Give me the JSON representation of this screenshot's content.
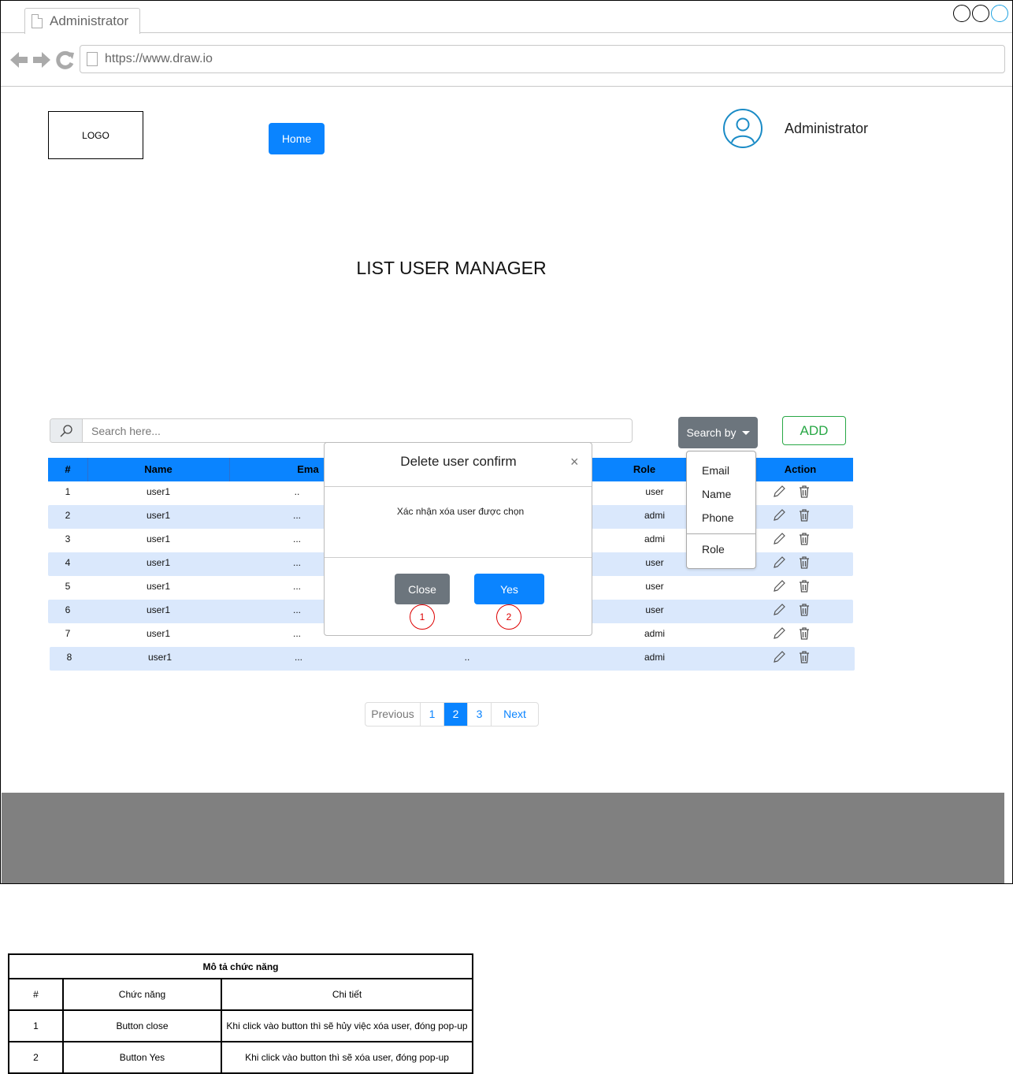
{
  "browser": {
    "tab_title": "Administrator",
    "url": "https://www.draw.io"
  },
  "header": {
    "logo": "LOGO",
    "home_button": "Home",
    "user_name": "Administrator"
  },
  "page_title": "LIST USER MANAGER",
  "toolbar": {
    "search_placeholder": "Search here...",
    "search_by_label": "Search by",
    "add_label": "ADD"
  },
  "search_by_menu": [
    "Email",
    "Name",
    "Phone",
    "Role"
  ],
  "table": {
    "columns": [
      "#",
      "Name",
      "Ema",
      "Role",
      "Action"
    ],
    "rows": [
      {
        "no": "1",
        "name": "user1",
        "email": "..",
        "phone": "",
        "role": "user"
      },
      {
        "no": "2",
        "name": "user1",
        "email": "...",
        "phone": "",
        "role": "admi"
      },
      {
        "no": "3",
        "name": "user1",
        "email": "...",
        "phone": "",
        "role": "admi"
      },
      {
        "no": "4",
        "name": "user1",
        "email": "...",
        "phone": "",
        "role": "user"
      },
      {
        "no": "5",
        "name": "user1",
        "email": "...",
        "phone": "",
        "role": "user"
      },
      {
        "no": "6",
        "name": "user1",
        "email": "...",
        "phone": "",
        "role": "user"
      },
      {
        "no": "7",
        "name": "user1",
        "email": "...",
        "phone": "",
        "role": "admi"
      },
      {
        "no": "8",
        "name": "user1",
        "email": "...",
        "phone": "..",
        "role": "admi"
      }
    ]
  },
  "modal": {
    "title": "Delete user confirm",
    "close_x": "×",
    "body": "Xác nhận xóa user được chọn",
    "close_button": "Close",
    "yes_button": "Yes",
    "markers": [
      "1",
      "2"
    ]
  },
  "pagination": {
    "previous": "Previous",
    "pages": [
      "1",
      "2",
      "3"
    ],
    "active_page": "2",
    "next": "Next"
  },
  "description_table": {
    "title": "Mô tả chức năng",
    "headers": [
      "#",
      "Chức năng",
      "Chi tiết"
    ],
    "rows": [
      [
        "1",
        "Button close",
        "Khi click vào button thì sẽ hủy việc xóa user, đóng pop-up"
      ],
      [
        "2",
        "Button Yes",
        "Khi click vào button thì sẽ xóa user, đóng pop-up"
      ]
    ]
  },
  "colors": {
    "primary": "#0a84ff",
    "secondary": "#6c757d",
    "success": "#28a745",
    "row_alt": "#dae8fc",
    "footer": "#808080",
    "marker": "#dd0000"
  },
  "icons": {
    "search": "magnifier-icon",
    "user": "user-circle-icon",
    "edit": "pencil-icon",
    "delete": "trash-icon"
  }
}
